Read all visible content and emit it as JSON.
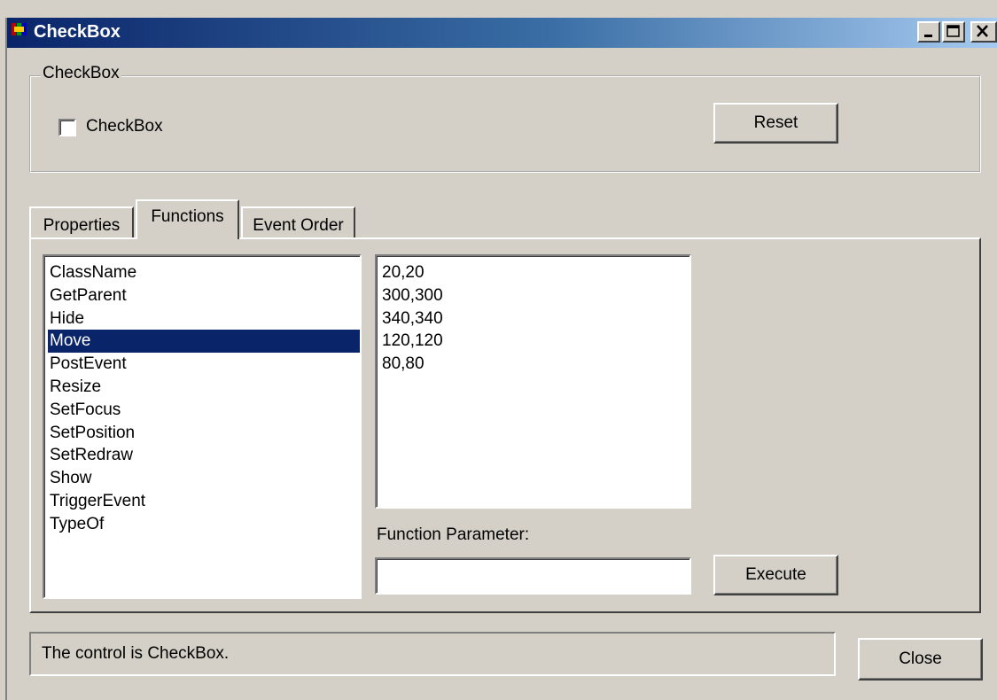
{
  "window": {
    "title": "CheckBox",
    "title_icon": "app-icon",
    "controls": [
      "minimize-icon",
      "maximize-icon",
      "close-icon"
    ]
  },
  "group": {
    "label": "CheckBox",
    "checkbox_label": "CheckBox",
    "checkbox_checked": false,
    "reset_label": "Reset"
  },
  "tabs": [
    {
      "label": "Properties",
      "active": false
    },
    {
      "label": "Functions",
      "active": true
    },
    {
      "label": "Event Order",
      "active": false
    }
  ],
  "functions": {
    "items": [
      "ClassName",
      "GetParent",
      "Hide",
      "Move",
      "PostEvent",
      "Resize",
      "SetFocus",
      "SetPosition",
      "SetRedraw",
      "Show",
      "TriggerEvent",
      "TypeOf"
    ],
    "selected": "Move",
    "values": [
      "20,20",
      "300,300",
      "340,340",
      "120,120",
      "80,80"
    ],
    "parameter_label": "Function Parameter:",
    "parameter_value": "",
    "execute_label": "Execute"
  },
  "status": {
    "text": "The control is CheckBox.",
    "close_label": "Close"
  },
  "colors": {
    "face": "#d4d0c8",
    "title_start": "#0a246a",
    "title_end": "#a6caf0",
    "selection": "#0a246a"
  }
}
